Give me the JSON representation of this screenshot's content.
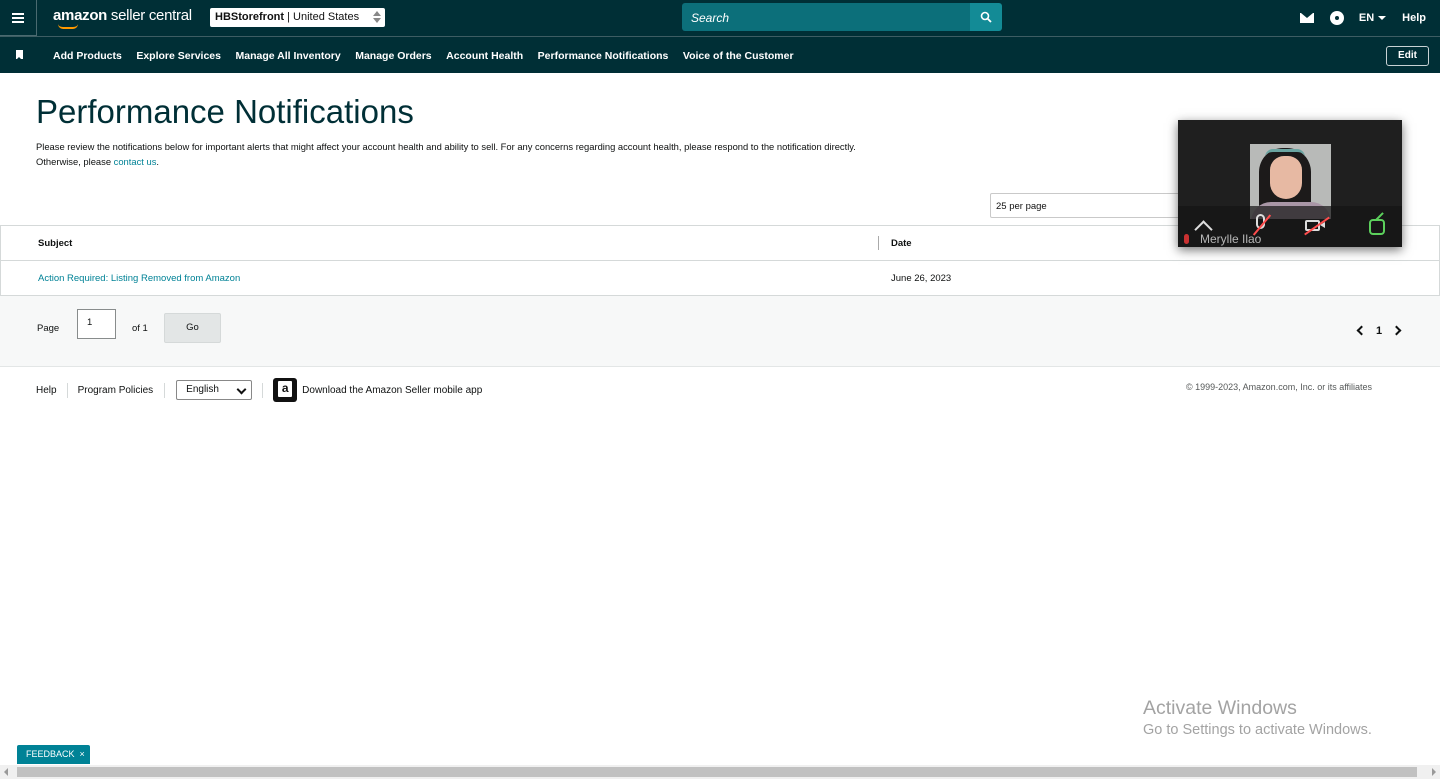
{
  "header": {
    "logo_text_strong": "amazon",
    "logo_text_rest": " seller central",
    "store_name": "HBStorefront",
    "store_region": " | United States",
    "search_placeholder": "Search",
    "language": "EN",
    "help_label": "Help"
  },
  "nav": {
    "items": [
      {
        "label": "Add Products"
      },
      {
        "label": "Explore Services"
      },
      {
        "label": "Manage All Inventory"
      },
      {
        "label": "Manage Orders"
      },
      {
        "label": "Account Health"
      },
      {
        "label": "Performance Notifications"
      },
      {
        "label": "Voice of the Customer"
      }
    ],
    "edit_label": "Edit"
  },
  "page": {
    "title": "Performance Notifications",
    "intro_line1": "Please review the notifications below for important alerts that might affect your account health and ability to sell. For any concerns regarding account health, please respond to the notification directly.",
    "intro_line2_prefix": "Otherwise, please ",
    "intro_link": "contact us",
    "intro_line2_suffix": ".",
    "per_page": "25 per page"
  },
  "table": {
    "columns": [
      "Subject",
      "Date"
    ],
    "rows": [
      {
        "subject": "Action Required: Listing Removed from Amazon",
        "date": "June 26, 2023"
      }
    ]
  },
  "pager": {
    "page_label": "Page",
    "page_value": "1",
    "of_label": "of 1",
    "go_label": "Go",
    "current_page": "1"
  },
  "footer": {
    "help": "Help",
    "program_policies": "Program Policies",
    "language_select": "English",
    "app_link": "Download the Amazon Seller mobile app",
    "copyright": "© 1999-2023, Amazon.com, Inc. or its affiliates"
  },
  "video_overlay": {
    "participant_name": "Merylle Ilao"
  },
  "system": {
    "watermark_title": "Activate Windows",
    "watermark_subtitle": "Go to Settings to activate Windows.",
    "feedback_label": "FEEDBACK",
    "feedback_close": "×"
  },
  "colors": {
    "header_bg": "#002f36",
    "search_bg": "#0c6f7a",
    "link": "#008296"
  },
  "icons": [
    "hamburger-icon",
    "search-icon",
    "mail-icon",
    "gear-icon",
    "bookmark-icon",
    "amazon-app-icon",
    "chevron-left-icon",
    "chevron-right-icon"
  ]
}
